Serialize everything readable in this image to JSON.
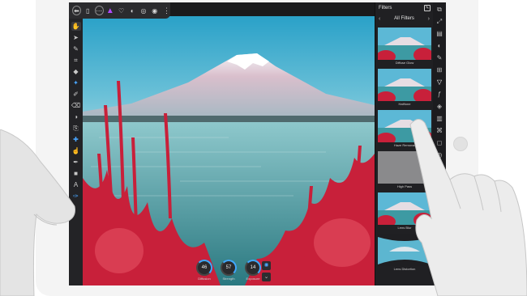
{
  "toolbar": {
    "items": [
      {
        "icon": "back-icon",
        "glyph": "⬅"
      },
      {
        "icon": "document-icon",
        "glyph": "▯"
      },
      {
        "icon": "more-icon",
        "glyph": "⋯"
      },
      {
        "icon": "affinity-logo-icon",
        "glyph": "▲"
      },
      {
        "icon": "persona-liquify-icon",
        "glyph": "♡"
      },
      {
        "icon": "persona-develop-icon",
        "glyph": "◐"
      },
      {
        "icon": "persona-tone-icon",
        "glyph": "◎"
      },
      {
        "icon": "persona-export-icon",
        "glyph": "◉"
      },
      {
        "icon": "menu-icon",
        "glyph": "⋮"
      }
    ]
  },
  "left_tools": [
    {
      "icon": "view-tool-icon",
      "glyph": "✋",
      "active": true
    },
    {
      "icon": "move-tool-icon",
      "glyph": "➤"
    },
    {
      "icon": "brush-tool-icon",
      "glyph": "✎"
    },
    {
      "icon": "crop-tool-icon",
      "glyph": "⌗"
    },
    {
      "icon": "fill-tool-icon",
      "glyph": "◆"
    },
    {
      "icon": "selection-brush-icon",
      "glyph": "✦",
      "blue": true
    },
    {
      "icon": "paint-brush-icon",
      "glyph": "✐"
    },
    {
      "icon": "eraser-icon",
      "glyph": "⌫"
    },
    {
      "icon": "dodge-burn-icon",
      "glyph": "◑"
    },
    {
      "icon": "clone-tool-icon",
      "glyph": "⎘"
    },
    {
      "icon": "healing-tool-icon",
      "glyph": "✚",
      "blue": true
    },
    {
      "icon": "smudge-tool-icon",
      "glyph": "☝"
    },
    {
      "icon": "color-picker-icon",
      "glyph": "✒"
    },
    {
      "icon": "shape-tool-icon",
      "glyph": "■"
    },
    {
      "icon": "text-tool-icon",
      "glyph": "A"
    },
    {
      "icon": "vector-pen-icon",
      "glyph": "✑",
      "blue": true
    }
  ],
  "filters_panel": {
    "title": "Filters",
    "nav_label": "All Filters",
    "filters": [
      {
        "label": "Diffuse Glow",
        "style": "normal"
      },
      {
        "label": "Halftone",
        "style": "normal"
      },
      {
        "label": "Haze Removal",
        "style": "normal"
      },
      {
        "label": "High Pass",
        "style": "grey"
      },
      {
        "label": "Lens Blur",
        "style": "normal"
      },
      {
        "label": "Lens Distortion",
        "style": "distort"
      }
    ]
  },
  "right_strip": [
    {
      "icon": "edit-icon",
      "glyph": "⧉"
    },
    {
      "icon": "fullscreen-icon",
      "glyph": "⤢"
    },
    {
      "icon": "layers-icon",
      "glyph": "▤"
    },
    {
      "icon": "adjustments-icon",
      "glyph": "◐"
    },
    {
      "icon": "brushes-icon",
      "glyph": "✎"
    },
    {
      "icon": "channels-icon",
      "glyph": "⊞"
    },
    {
      "icon": "filters-icon",
      "glyph": "▽",
      "hl": true
    },
    {
      "icon": "fx-icon",
      "glyph": "ƒ"
    },
    {
      "icon": "navigator-icon",
      "glyph": "◈"
    },
    {
      "icon": "histogram-icon",
      "glyph": "▥"
    },
    {
      "icon": "transform-icon",
      "glyph": "⌘"
    },
    {
      "icon": "stock-icon",
      "glyph": "◻"
    },
    {
      "icon": "history-icon",
      "glyph": "◷"
    }
  ],
  "dials": [
    {
      "name": "Diffusion",
      "value": "46",
      "unit": "%"
    },
    {
      "name": "Strength",
      "value": "57",
      "unit": "%"
    },
    {
      "name": "Exposure",
      "value": "14",
      "unit": "%"
    }
  ],
  "colors": {
    "accent": "#3fa9ff",
    "reeds": "#d9293c",
    "panel_bg": "#202023"
  }
}
